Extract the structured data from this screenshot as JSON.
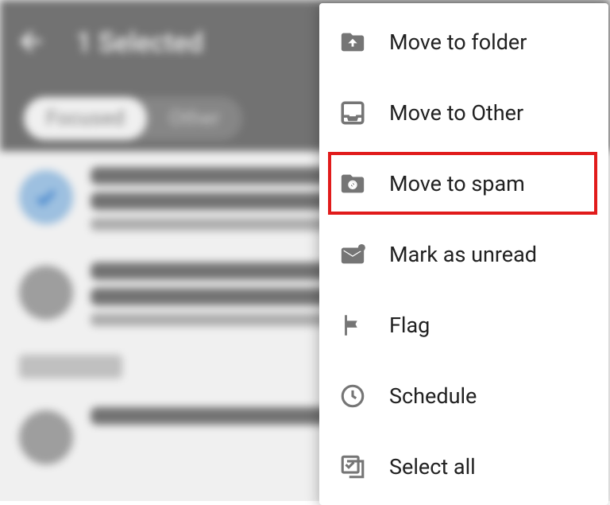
{
  "header": {
    "title": "1 Selected"
  },
  "tabs": {
    "focused": "Focused",
    "other": "Other"
  },
  "menu": {
    "move_folder": "Move to folder",
    "move_other": "Move to Other",
    "move_spam": "Move to spam",
    "mark_unread": "Mark as unread",
    "flag": "Flag",
    "schedule": "Schedule",
    "select_all": "Select all"
  }
}
